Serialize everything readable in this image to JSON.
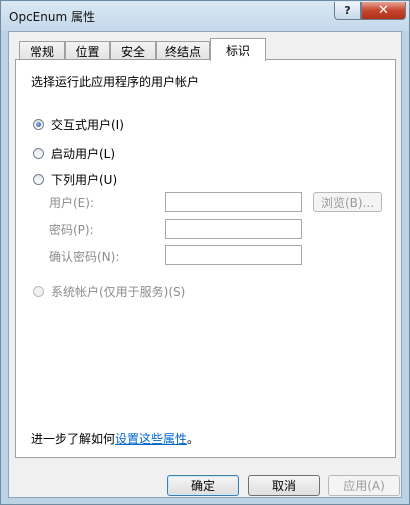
{
  "window": {
    "title": "OpcEnum 属性",
    "help_glyph": "?",
    "close_glyph": "✕"
  },
  "tabs": [
    {
      "label": "常规"
    },
    {
      "label": "位置"
    },
    {
      "label": "安全"
    },
    {
      "label": "终结点"
    },
    {
      "label": "标识",
      "active": true
    }
  ],
  "identity": {
    "heading": "选择运行此应用程序的用户帐户",
    "options": [
      {
        "label": "交互式用户(I)",
        "selected": true,
        "enabled": true
      },
      {
        "label": "启动用户(L)",
        "selected": false,
        "enabled": true
      },
      {
        "label": "下列用户(U)",
        "selected": false,
        "enabled": true
      },
      {
        "label": "系统帐户(仅用于服务)(S)",
        "selected": false,
        "enabled": false
      }
    ],
    "fields": {
      "user_label": "用户(E):",
      "user_value": "",
      "browse_label": "浏览(B)...",
      "password_label": "密码(P):",
      "password_value": "",
      "confirm_label": "确认密码(N):",
      "confirm_value": ""
    },
    "learn_more_prefix": "进一步了解如何",
    "learn_more_link": "设置这些属性",
    "learn_more_suffix": "。"
  },
  "buttons": {
    "ok": "确定",
    "cancel": "取消",
    "apply": "应用(A)"
  }
}
